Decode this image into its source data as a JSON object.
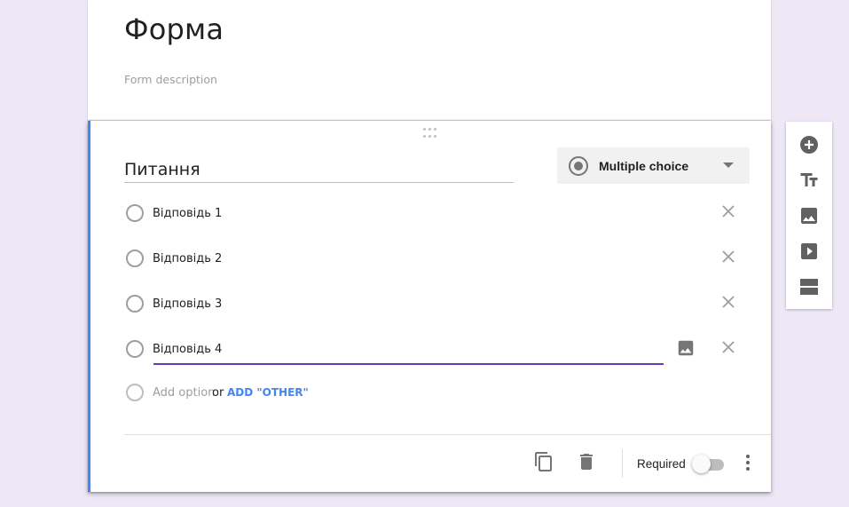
{
  "form": {
    "title": "Форма",
    "description_placeholder": "Form description"
  },
  "question": {
    "title": "Питання",
    "type_label": "Multiple choice",
    "options": [
      {
        "label": "Відповідь 1"
      },
      {
        "label": "Відповідь 2"
      },
      {
        "label": "Відповідь 3"
      },
      {
        "label": "Відповідь 4"
      }
    ],
    "add_option_label": "Add option",
    "or_label": "or",
    "add_other_label": "ADD \"OTHER\"",
    "required_label": "Required",
    "required": false
  },
  "toolbar": {
    "icons": [
      "add-question-icon",
      "add-title-icon",
      "add-image-icon",
      "add-video-icon",
      "add-section-icon"
    ]
  },
  "colors": {
    "background": "#ede7f6",
    "accent_bar": "#4285f4",
    "active_underline": "#673ab7",
    "link": "#4285f4"
  }
}
